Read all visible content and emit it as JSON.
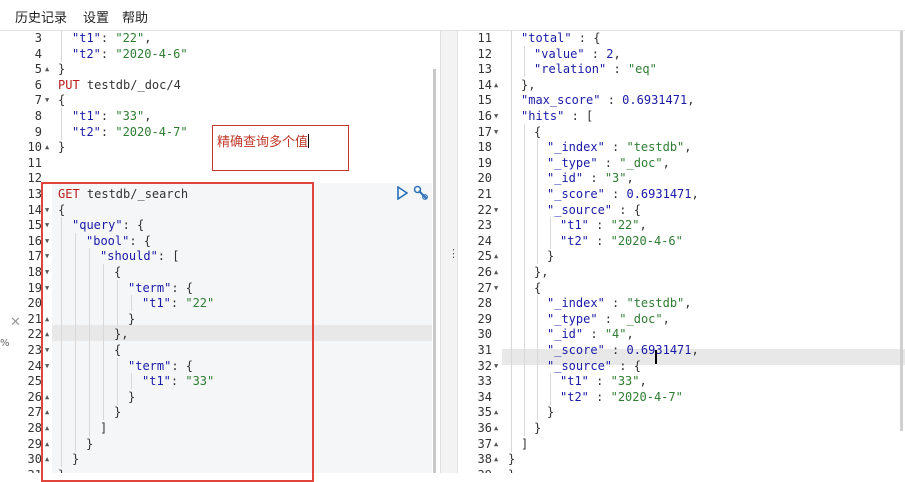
{
  "menu": {
    "history": "历史记录",
    "settings": "设置",
    "help": "帮助"
  },
  "annotation": {
    "text": "精确查询多个值"
  },
  "left_editor": {
    "lines": [
      {
        "n": "3",
        "fold": "",
        "indent": 1,
        "tokens": [
          {
            "t": "\"t1\"",
            "c": "k"
          },
          {
            "t": ": ",
            "c": "p"
          },
          {
            "t": "\"22\"",
            "c": "s"
          },
          {
            "t": ",",
            "c": "p"
          }
        ]
      },
      {
        "n": "4",
        "fold": "",
        "indent": 1,
        "tokens": [
          {
            "t": "\"t2\"",
            "c": "k"
          },
          {
            "t": ": ",
            "c": "p"
          },
          {
            "t": "\"2020-4-6\"",
            "c": "s"
          }
        ]
      },
      {
        "n": "5",
        "fold": "▲",
        "indent": 0,
        "tokens": [
          {
            "t": "}",
            "c": "p"
          }
        ]
      },
      {
        "n": "6",
        "fold": "",
        "indent": 0,
        "tokens": [
          {
            "t": "PUT",
            "c": "m"
          },
          {
            "t": " testdb/_doc/4",
            "c": "p"
          }
        ]
      },
      {
        "n": "7",
        "fold": "▼",
        "indent": 0,
        "tokens": [
          {
            "t": "{",
            "c": "p"
          }
        ]
      },
      {
        "n": "8",
        "fold": "",
        "indent": 1,
        "tokens": [
          {
            "t": "\"t1\"",
            "c": "k"
          },
          {
            "t": ": ",
            "c": "p"
          },
          {
            "t": "\"33\"",
            "c": "s"
          },
          {
            "t": ",",
            "c": "p"
          }
        ]
      },
      {
        "n": "9",
        "fold": "",
        "indent": 1,
        "tokens": [
          {
            "t": "\"t2\"",
            "c": "k"
          },
          {
            "t": ": ",
            "c": "p"
          },
          {
            "t": "\"2020-4-7\"",
            "c": "s"
          }
        ]
      },
      {
        "n": "10",
        "fold": "▲",
        "indent": 0,
        "tokens": [
          {
            "t": "}",
            "c": "p"
          }
        ]
      },
      {
        "n": "11",
        "fold": "",
        "indent": 0,
        "tokens": []
      },
      {
        "n": "12",
        "fold": "",
        "indent": 0,
        "tokens": []
      },
      {
        "n": "13",
        "fold": "",
        "indent": 0,
        "tokens": [
          {
            "t": "GET",
            "c": "m"
          },
          {
            "t": " testdb/_search",
            "c": "p"
          }
        ]
      },
      {
        "n": "14",
        "fold": "▼",
        "indent": 0,
        "tokens": [
          {
            "t": "{",
            "c": "p"
          }
        ]
      },
      {
        "n": "15",
        "fold": "▼",
        "indent": 1,
        "tokens": [
          {
            "t": "\"query\"",
            "c": "k"
          },
          {
            "t": ": {",
            "c": "p"
          }
        ]
      },
      {
        "n": "16",
        "fold": "▼",
        "indent": 2,
        "tokens": [
          {
            "t": "\"bool\"",
            "c": "k"
          },
          {
            "t": ": {",
            "c": "p"
          }
        ]
      },
      {
        "n": "17",
        "fold": "▼",
        "indent": 3,
        "tokens": [
          {
            "t": "\"should\"",
            "c": "k"
          },
          {
            "t": ": [",
            "c": "p"
          }
        ]
      },
      {
        "n": "18",
        "fold": "▼",
        "indent": 4,
        "tokens": [
          {
            "t": "{",
            "c": "p"
          }
        ]
      },
      {
        "n": "19",
        "fold": "▼",
        "indent": 5,
        "tokens": [
          {
            "t": "\"term\"",
            "c": "k"
          },
          {
            "t": ": {",
            "c": "p"
          }
        ]
      },
      {
        "n": "20",
        "fold": "",
        "indent": 6,
        "tokens": [
          {
            "t": "\"t1\"",
            "c": "k"
          },
          {
            "t": ": ",
            "c": "p"
          },
          {
            "t": "\"22\"",
            "c": "s"
          }
        ]
      },
      {
        "n": "21",
        "fold": "▲",
        "indent": 5,
        "tokens": [
          {
            "t": "}",
            "c": "p"
          }
        ]
      },
      {
        "n": "22",
        "fold": "▲",
        "indent": 4,
        "tokens": [
          {
            "t": "},",
            "c": "p"
          }
        ]
      },
      {
        "n": "23",
        "fold": "▼",
        "indent": 4,
        "tokens": [
          {
            "t": "{",
            "c": "p"
          }
        ]
      },
      {
        "n": "24",
        "fold": "▼",
        "indent": 5,
        "tokens": [
          {
            "t": "\"term\"",
            "c": "k"
          },
          {
            "t": ": {",
            "c": "p"
          }
        ]
      },
      {
        "n": "25",
        "fold": "",
        "indent": 6,
        "tokens": [
          {
            "t": "\"t1\"",
            "c": "k"
          },
          {
            "t": ": ",
            "c": "p"
          },
          {
            "t": "\"33\"",
            "c": "s"
          }
        ]
      },
      {
        "n": "26",
        "fold": "▲",
        "indent": 5,
        "tokens": [
          {
            "t": "}",
            "c": "p"
          }
        ]
      },
      {
        "n": "27",
        "fold": "▲",
        "indent": 4,
        "tokens": [
          {
            "t": "}",
            "c": "p"
          }
        ]
      },
      {
        "n": "28",
        "fold": "▲",
        "indent": 3,
        "tokens": [
          {
            "t": "]",
            "c": "p"
          }
        ]
      },
      {
        "n": "29",
        "fold": "▲",
        "indent": 2,
        "tokens": [
          {
            "t": "}",
            "c": "p"
          }
        ]
      },
      {
        "n": "30",
        "fold": "▲",
        "indent": 1,
        "tokens": [
          {
            "t": "}",
            "c": "p"
          }
        ]
      },
      {
        "n": "31",
        "fold": "▲",
        "indent": 0,
        "tokens": [
          {
            "t": "}",
            "c": "p"
          }
        ]
      }
    ]
  },
  "right_editor": {
    "lines": [
      {
        "n": "11",
        "fold": "",
        "indent": 1,
        "tokens": [
          {
            "t": "\"total\"",
            "c": "k"
          },
          {
            "t": " : {",
            "c": "p"
          }
        ]
      },
      {
        "n": "12",
        "fold": "",
        "indent": 2,
        "tokens": [
          {
            "t": "\"value\"",
            "c": "k"
          },
          {
            "t": " : ",
            "c": "p"
          },
          {
            "t": "2",
            "c": "n"
          },
          {
            "t": ",",
            "c": "p"
          }
        ]
      },
      {
        "n": "13",
        "fold": "",
        "indent": 2,
        "tokens": [
          {
            "t": "\"relation\"",
            "c": "k"
          },
          {
            "t": " : ",
            "c": "p"
          },
          {
            "t": "\"eq\"",
            "c": "s"
          }
        ]
      },
      {
        "n": "14",
        "fold": "▲",
        "indent": 1,
        "tokens": [
          {
            "t": "},",
            "c": "p"
          }
        ]
      },
      {
        "n": "15",
        "fold": "",
        "indent": 1,
        "tokens": [
          {
            "t": "\"max_score\"",
            "c": "k"
          },
          {
            "t": " : ",
            "c": "p"
          },
          {
            "t": "0.6931471",
            "c": "n"
          },
          {
            "t": ",",
            "c": "p"
          }
        ]
      },
      {
        "n": "16",
        "fold": "▼",
        "indent": 1,
        "tokens": [
          {
            "t": "\"hits\"",
            "c": "k"
          },
          {
            "t": " : [",
            "c": "p"
          }
        ]
      },
      {
        "n": "17",
        "fold": "▼",
        "indent": 2,
        "tokens": [
          {
            "t": "{",
            "c": "p"
          }
        ]
      },
      {
        "n": "18",
        "fold": "",
        "indent": 3,
        "tokens": [
          {
            "t": "\"_index\"",
            "c": "k"
          },
          {
            "t": " : ",
            "c": "p"
          },
          {
            "t": "\"testdb\"",
            "c": "s"
          },
          {
            "t": ",",
            "c": "p"
          }
        ]
      },
      {
        "n": "19",
        "fold": "",
        "indent": 3,
        "tokens": [
          {
            "t": "\"_type\"",
            "c": "k"
          },
          {
            "t": " : ",
            "c": "p"
          },
          {
            "t": "\"_doc\"",
            "c": "s"
          },
          {
            "t": ",",
            "c": "p"
          }
        ]
      },
      {
        "n": "20",
        "fold": "",
        "indent": 3,
        "tokens": [
          {
            "t": "\"_id\"",
            "c": "k"
          },
          {
            "t": " : ",
            "c": "p"
          },
          {
            "t": "\"3\"",
            "c": "s"
          },
          {
            "t": ",",
            "c": "p"
          }
        ]
      },
      {
        "n": "21",
        "fold": "",
        "indent": 3,
        "tokens": [
          {
            "t": "\"_score\"",
            "c": "k"
          },
          {
            "t": " : ",
            "c": "p"
          },
          {
            "t": "0.6931471",
            "c": "n"
          },
          {
            "t": ",",
            "c": "p"
          }
        ]
      },
      {
        "n": "22",
        "fold": "▼",
        "indent": 3,
        "tokens": [
          {
            "t": "\"_source\"",
            "c": "k"
          },
          {
            "t": " : {",
            "c": "p"
          }
        ]
      },
      {
        "n": "23",
        "fold": "",
        "indent": 4,
        "tokens": [
          {
            "t": "\"t1\"",
            "c": "k"
          },
          {
            "t": " : ",
            "c": "p"
          },
          {
            "t": "\"22\"",
            "c": "s"
          },
          {
            "t": ",",
            "c": "p"
          }
        ]
      },
      {
        "n": "24",
        "fold": "",
        "indent": 4,
        "tokens": [
          {
            "t": "\"t2\"",
            "c": "k"
          },
          {
            "t": " : ",
            "c": "p"
          },
          {
            "t": "\"2020-4-6\"",
            "c": "s"
          }
        ]
      },
      {
        "n": "25",
        "fold": "▲",
        "indent": 3,
        "tokens": [
          {
            "t": "}",
            "c": "p"
          }
        ]
      },
      {
        "n": "26",
        "fold": "▲",
        "indent": 2,
        "tokens": [
          {
            "t": "},",
            "c": "p"
          }
        ]
      },
      {
        "n": "27",
        "fold": "▼",
        "indent": 2,
        "tokens": [
          {
            "t": "{",
            "c": "p"
          }
        ]
      },
      {
        "n": "28",
        "fold": "",
        "indent": 3,
        "tokens": [
          {
            "t": "\"_index\"",
            "c": "k"
          },
          {
            "t": " : ",
            "c": "p"
          },
          {
            "t": "\"testdb\"",
            "c": "s"
          },
          {
            "t": ",",
            "c": "p"
          }
        ]
      },
      {
        "n": "29",
        "fold": "",
        "indent": 3,
        "tokens": [
          {
            "t": "\"_type\"",
            "c": "k"
          },
          {
            "t": " : ",
            "c": "p"
          },
          {
            "t": "\"_doc\"",
            "c": "s"
          },
          {
            "t": ",",
            "c": "p"
          }
        ]
      },
      {
        "n": "30",
        "fold": "",
        "indent": 3,
        "tokens": [
          {
            "t": "\"_id\"",
            "c": "k"
          },
          {
            "t": " : ",
            "c": "p"
          },
          {
            "t": "\"4\"",
            "c": "s"
          },
          {
            "t": ",",
            "c": "p"
          }
        ]
      },
      {
        "n": "31",
        "fold": "",
        "indent": 3,
        "tokens": [
          {
            "t": "\"_score\"",
            "c": "k"
          },
          {
            "t": " : ",
            "c": "p"
          },
          {
            "t": "0.6931471",
            "c": "n"
          },
          {
            "t": ",",
            "c": "p"
          }
        ]
      },
      {
        "n": "32",
        "fold": "▼",
        "indent": 3,
        "tokens": [
          {
            "t": "\"_source\"",
            "c": "k"
          },
          {
            "t": " : {",
            "c": "p"
          }
        ]
      },
      {
        "n": "33",
        "fold": "",
        "indent": 4,
        "tokens": [
          {
            "t": "\"t1\"",
            "c": "k"
          },
          {
            "t": " : ",
            "c": "p"
          },
          {
            "t": "\"33\"",
            "c": "s"
          },
          {
            "t": ",",
            "c": "p"
          }
        ]
      },
      {
        "n": "34",
        "fold": "",
        "indent": 4,
        "tokens": [
          {
            "t": "\"t2\"",
            "c": "k"
          },
          {
            "t": " : ",
            "c": "p"
          },
          {
            "t": "\"2020-4-7\"",
            "c": "s"
          }
        ]
      },
      {
        "n": "35",
        "fold": "▲",
        "indent": 3,
        "tokens": [
          {
            "t": "}",
            "c": "p"
          }
        ]
      },
      {
        "n": "36",
        "fold": "▲",
        "indent": 2,
        "tokens": [
          {
            "t": "}",
            "c": "p"
          }
        ]
      },
      {
        "n": "37",
        "fold": "▲",
        "indent": 1,
        "tokens": [
          {
            "t": "]",
            "c": "p"
          }
        ]
      },
      {
        "n": "38",
        "fold": "▲",
        "indent": 0,
        "tokens": [
          {
            "t": "}",
            "c": "p"
          }
        ]
      },
      {
        "n": "39",
        "fold": "▲",
        "indent": 0,
        "tokens": [
          {
            "t": "}",
            "c": "p"
          }
        ]
      }
    ]
  },
  "edge_labels": {
    "close_mark": "✕",
    "percent_mark": "%",
    "divider_dots": "⋮"
  },
  "colors": {
    "annotation_red": "#c0392b",
    "request_highlight": "#e0443b",
    "method": "#b91c1c",
    "key": "#1a1aa6",
    "string": "#2e7d32"
  }
}
